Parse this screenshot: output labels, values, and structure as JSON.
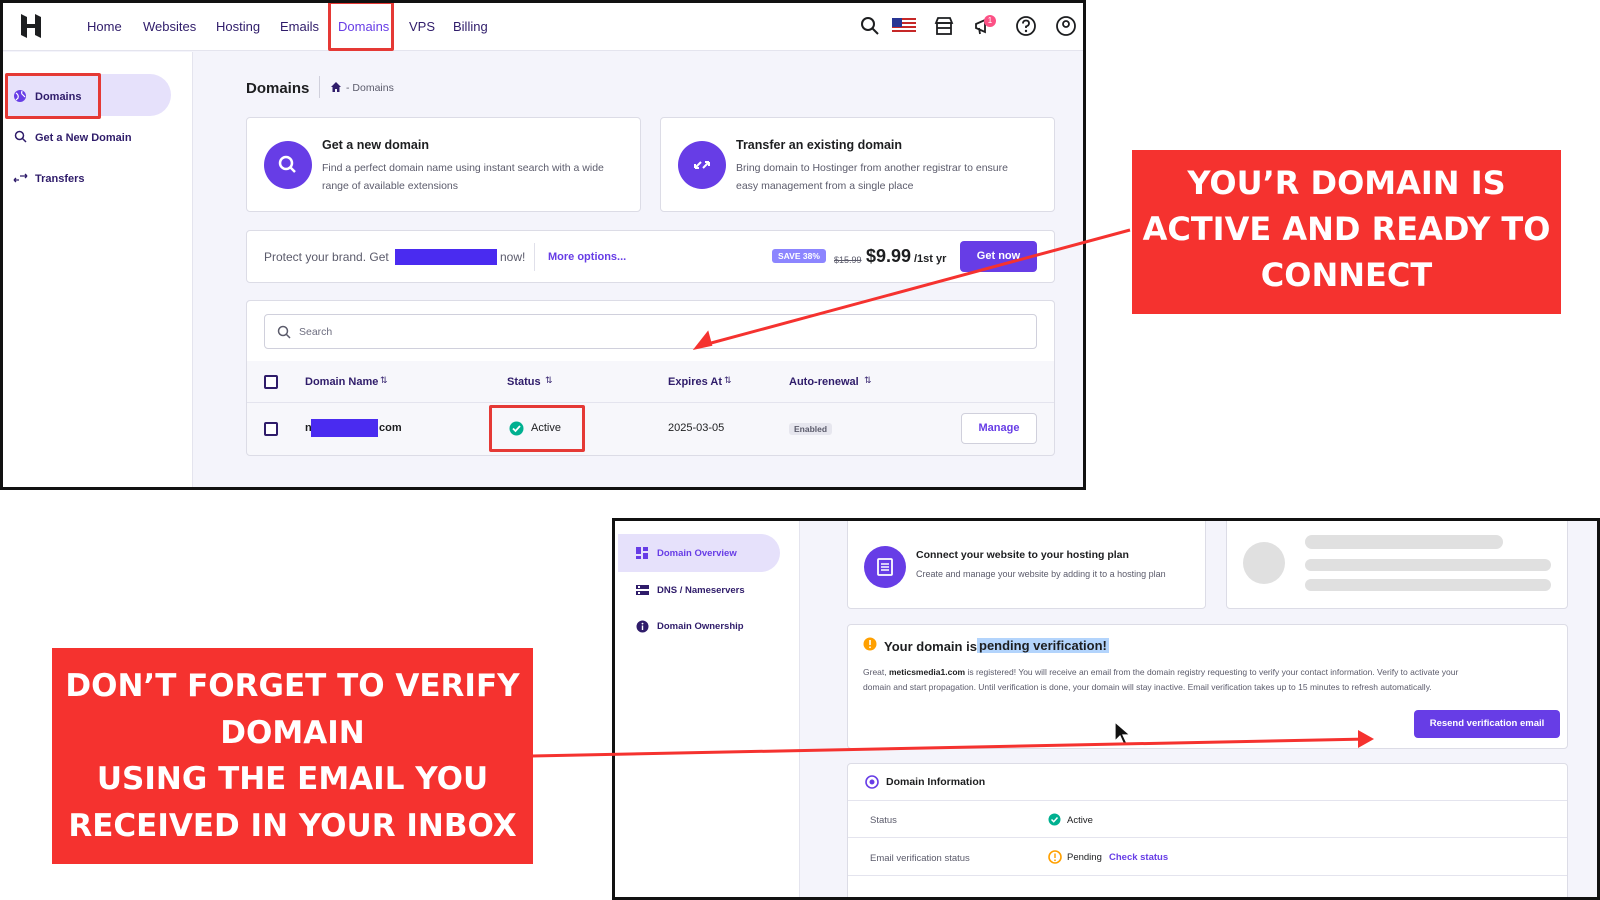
{
  "top_screen": {
    "nav": [
      "Home",
      "Websites",
      "Hosting",
      "Emails",
      "Domains",
      "VPS",
      "Billing"
    ],
    "notification_count": "1",
    "sidebar": [
      "Domains",
      "Get a New Domain",
      "Transfers"
    ],
    "page_title": "Domains",
    "breadcrumb": "- Domains",
    "card_new": {
      "title": "Get a new domain",
      "desc1": "Find a perfect domain name using instant search with a wide",
      "desc2": "range of available extensions"
    },
    "card_transfer": {
      "title": "Transfer an existing domain",
      "desc1": "Bring domain to Hostinger from another registrar to ensure",
      "desc2": "easy management from a single place"
    },
    "promo": {
      "prefix": "Protect your brand. Get",
      "suffix": "now!",
      "more": "More options...",
      "badge": "SAVE 38%",
      "old_price": "$15.99",
      "price": "$9.99",
      "period": "/1st yr",
      "button": "Get now"
    },
    "search_placeholder": "Search",
    "table": {
      "headers": [
        "Domain Name",
        "Status",
        "Expires At",
        "Auto-renewal"
      ],
      "row": {
        "name_start": "n",
        "name_end": "com",
        "status": "Active",
        "expires": "2025-03-05",
        "renewal": "Enabled",
        "action": "Manage"
      }
    }
  },
  "callout_top": [
    "YOU’R DOMAIN IS",
    "ACTIVE AND READY TO",
    "CONNECT"
  ],
  "callout_bottom": [
    "DON’T FORGET TO VERIFY",
    "DOMAIN",
    "USING THE EMAIL YOU",
    "RECEIVED IN YOUR INBOX"
  ],
  "bottom_screen": {
    "sidebar": [
      "Domain Overview",
      "DNS / Nameservers",
      "Domain Ownership"
    ],
    "connect": {
      "title": "Connect your website to your hosting plan",
      "desc": "Create and manage your website by adding it to a hosting plan"
    },
    "pending": {
      "title_prefix": "Your domain is",
      "title_highlight": "pending verification!",
      "line1_a": "Great,",
      "domain": "meticsmedia1.com",
      "line1_b": "is registered! You will receive an email from the domain registry requesting to verify your contact information. Verify to activate your",
      "line2": "domain and start propagation. Until verification is done, your domain will stay inactive. Email verification takes up to 15 minutes to refresh automatically.",
      "button": "Resend verification email"
    },
    "info": {
      "title": "Domain Information",
      "status_label": "Status",
      "status_value": "Active",
      "email_label": "Email verification status",
      "email_value": "Pending",
      "check": "Check status"
    }
  },
  "colors": {
    "brand": "#673de6",
    "callout": "#f5322f",
    "active": "#00b090",
    "pending": "#ffa000"
  }
}
